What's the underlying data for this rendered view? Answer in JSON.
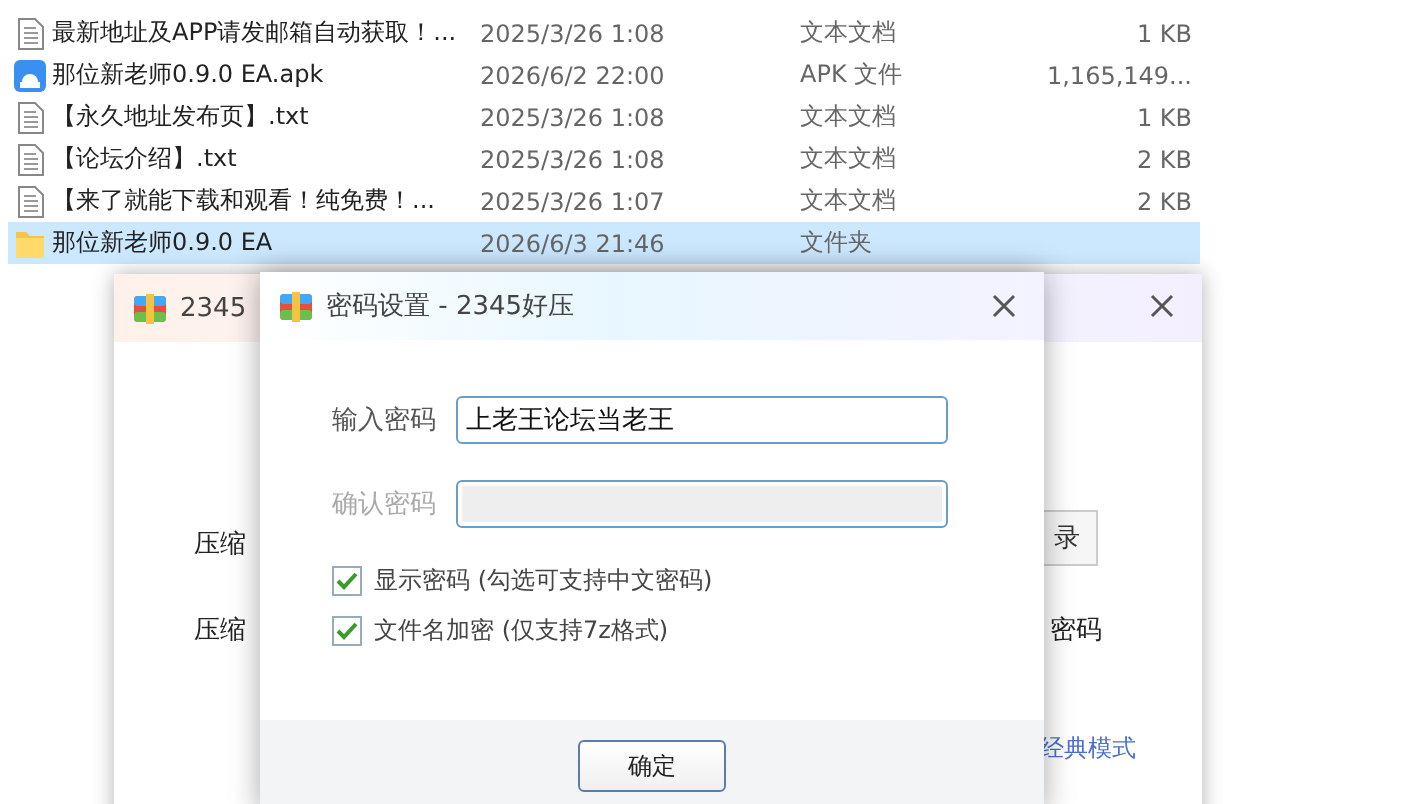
{
  "files": [
    {
      "name": "最新地址及APP请发邮箱自动获取！...",
      "date": "2025/3/26 1:08",
      "type": "文本文档",
      "size": "1 KB",
      "kind": "text",
      "selected": false
    },
    {
      "name": "那位新老师0.9.0 EA.apk",
      "date": "2026/6/2 22:00",
      "type": "APK 文件",
      "size": "1,165,149...",
      "kind": "apk",
      "selected": false
    },
    {
      "name": "【永久地址发布页】.txt",
      "date": "2025/3/26 1:08",
      "type": "文本文档",
      "size": "1 KB",
      "kind": "text",
      "selected": false
    },
    {
      "name": "【论坛介绍】.txt",
      "date": "2025/3/26 1:08",
      "type": "文本文档",
      "size": "2 KB",
      "kind": "text",
      "selected": false
    },
    {
      "name": "【来了就能下载和观看！纯免费！...",
      "date": "2025/3/26 1:07",
      "type": "文本文档",
      "size": "2 KB",
      "kind": "text",
      "selected": false
    },
    {
      "name": "那位新老师0.9.0 EA",
      "date": "2026/6/3 21:46",
      "type": "文件夹",
      "kind": "folder",
      "selected": true
    }
  ],
  "back_window": {
    "title": "2345",
    "label_1": "压缩",
    "label_2": "压缩",
    "button": "录",
    "label_3": "密码",
    "link": "经典模式"
  },
  "dialog": {
    "title": "密码设置 - 2345好压",
    "fields": [
      {
        "label": "输入密码",
        "value": "上老王论坛当老王",
        "disabled": false
      },
      {
        "label": "确认密码",
        "disabled": true
      }
    ],
    "options": [
      {
        "label": "显示密码 (勾选可支持中文密码)",
        "checked": true
      },
      {
        "label": "文件名加密  (仅支持7z格式)",
        "checked": true
      }
    ],
    "ok_button": "确定"
  }
}
